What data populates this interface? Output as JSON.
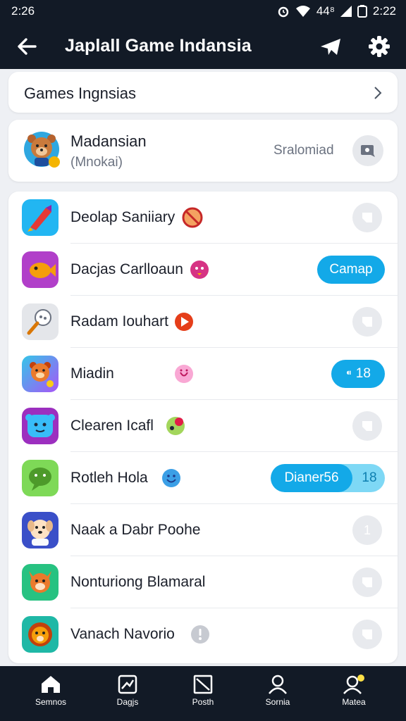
{
  "status_bar": {
    "time_left": "2:26",
    "signal_text": "44⁸",
    "time_right": "2:22"
  },
  "app_bar": {
    "title": "Japlall Game Indansia"
  },
  "games_link": {
    "label": "Games Ingnsias"
  },
  "profile": {
    "name": "Madansian",
    "subtitle": "(Mnokai)",
    "status": "Sralomiad"
  },
  "games": [
    {
      "title": "Deolap Saniiary"
    },
    {
      "title": "Dacjas Carlloaun",
      "pill_label": "Camap"
    },
    {
      "title": "Radam Iouhart"
    },
    {
      "title": "Miadin",
      "pill_label": "⁌ 18"
    },
    {
      "title": "Clearen Icafl"
    },
    {
      "title": "Rotleh Hola",
      "pill_label": "Dianer56",
      "pill_extra": "18"
    },
    {
      "title": "Naak a Dabr Poohe",
      "counter": "1"
    },
    {
      "title": "Nonturiong Blamaral"
    },
    {
      "title": "Vanach Navorio"
    }
  ],
  "bottom_nav": [
    {
      "label": "Semnos",
      "icon": "home-icon"
    },
    {
      "label": "Dagjs",
      "icon": "image-icon"
    },
    {
      "label": "Posth",
      "icon": "picture-icon"
    },
    {
      "label": "Sornia",
      "icon": "person-icon"
    },
    {
      "label": "Matea",
      "icon": "profile-icon"
    }
  ],
  "colors": {
    "bar": "#121a26",
    "accent": "#13a9e8",
    "background": "#eef0f4"
  }
}
